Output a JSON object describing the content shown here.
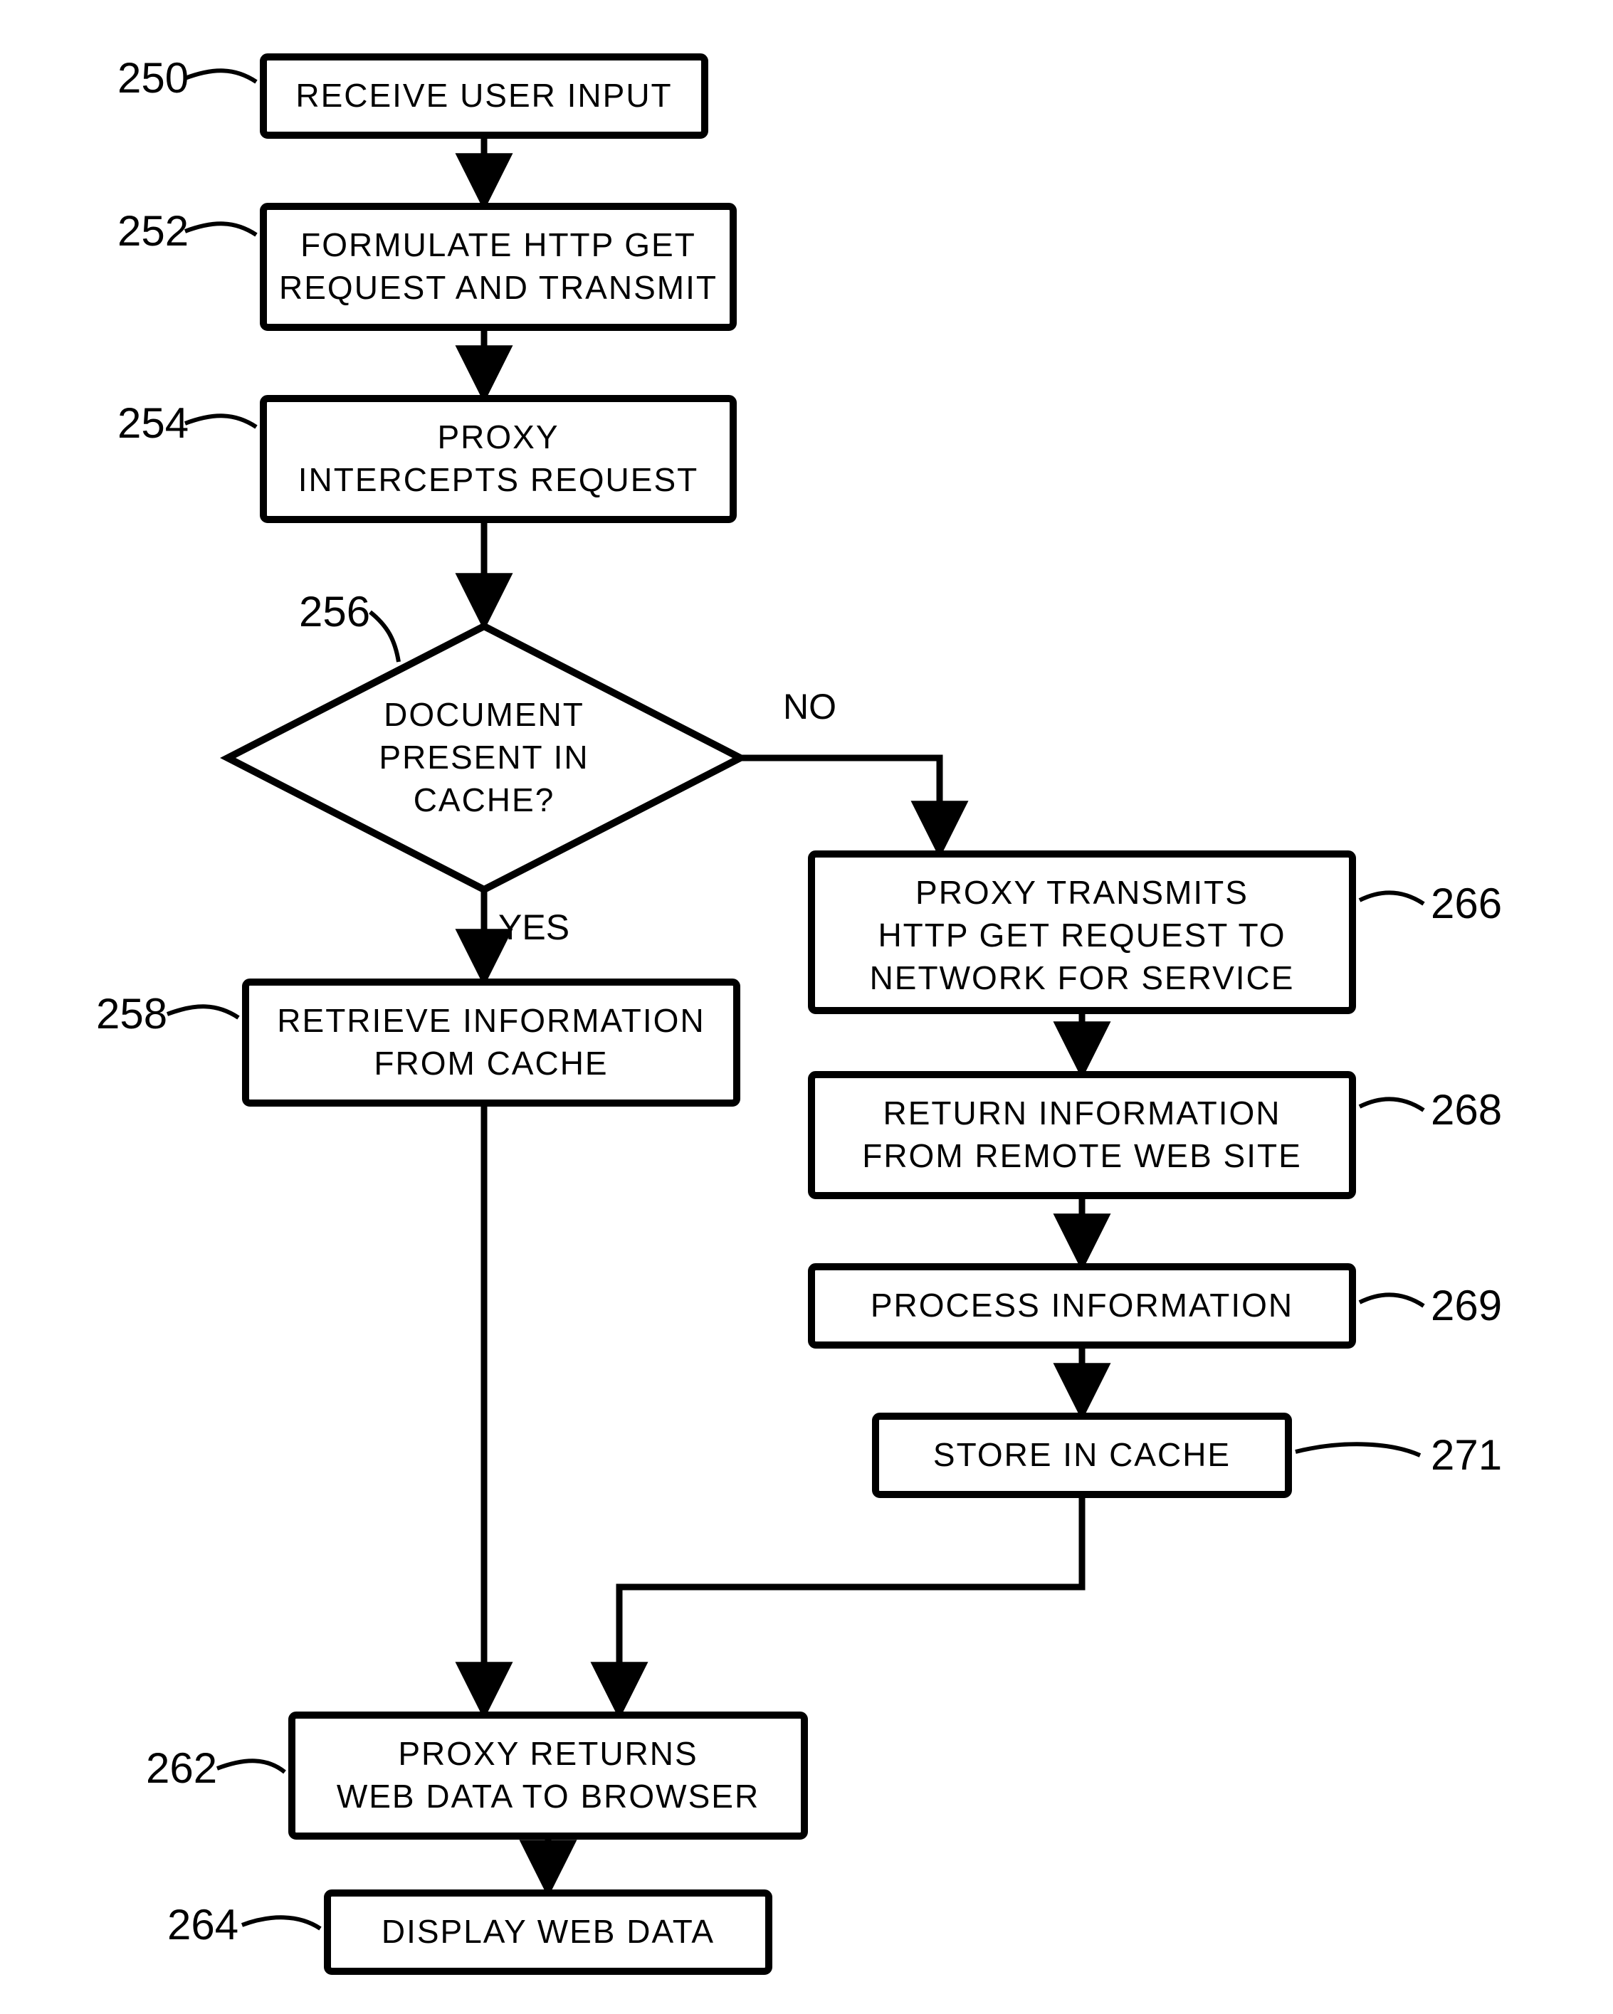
{
  "nodes": {
    "n250": {
      "ref": "250",
      "lines": [
        "RECEIVE USER INPUT"
      ]
    },
    "n252": {
      "ref": "252",
      "lines": [
        "FORMULATE HTTP GET",
        "REQUEST AND TRANSMIT"
      ]
    },
    "n254": {
      "ref": "254",
      "lines": [
        "PROXY",
        "INTERCEPTS REQUEST"
      ]
    },
    "n256": {
      "ref": "256",
      "lines": [
        "DOCUMENT",
        "PRESENT IN",
        "CACHE?"
      ]
    },
    "n258": {
      "ref": "258",
      "lines": [
        "RETRIEVE INFORMATION",
        "FROM CACHE"
      ]
    },
    "n262": {
      "ref": "262",
      "lines": [
        "PROXY RETURNS",
        "WEB DATA TO BROWSER"
      ]
    },
    "n264": {
      "ref": "264",
      "lines": [
        "DISPLAY WEB DATA"
      ]
    },
    "n266": {
      "ref": "266",
      "lines": [
        "PROXY TRANSMITS",
        "HTTP GET REQUEST TO",
        "NETWORK FOR SERVICE"
      ]
    },
    "n268": {
      "ref": "268",
      "lines": [
        "RETURN INFORMATION",
        "FROM REMOTE WEB SITE"
      ]
    },
    "n269": {
      "ref": "269",
      "lines": [
        "PROCESS INFORMATION"
      ]
    },
    "n271": {
      "ref": "271",
      "lines": [
        "STORE IN CACHE"
      ]
    }
  },
  "branches": {
    "yes": "YES",
    "no": "NO"
  }
}
